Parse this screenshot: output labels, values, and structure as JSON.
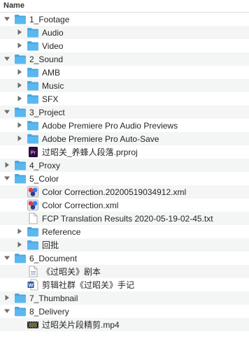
{
  "header": {
    "column_name": "Name"
  },
  "colors": {
    "folder": "#5bb8ef",
    "folder_tab": "#4aa6df",
    "row_alt": "#f4f5f5",
    "premiere": "#2a0f3d",
    "premiere_text": "#e18ef2",
    "word": "#2b579a"
  },
  "rows": [
    {
      "name": "1_Footage",
      "depth": 0,
      "icon": "folder-icon",
      "expandable": true,
      "expanded": true
    },
    {
      "name": "Audio",
      "depth": 1,
      "icon": "folder-icon",
      "expandable": true,
      "expanded": false
    },
    {
      "name": "Video",
      "depth": 1,
      "icon": "folder-icon",
      "expandable": true,
      "expanded": false
    },
    {
      "name": "2_Sound",
      "depth": 0,
      "icon": "folder-icon",
      "expandable": true,
      "expanded": true
    },
    {
      "name": "AMB",
      "depth": 1,
      "icon": "folder-icon",
      "expandable": true,
      "expanded": false
    },
    {
      "name": "Music",
      "depth": 1,
      "icon": "folder-icon",
      "expandable": true,
      "expanded": false
    },
    {
      "name": "SFX",
      "depth": 1,
      "icon": "folder-icon",
      "expandable": true,
      "expanded": false
    },
    {
      "name": "3_Project",
      "depth": 0,
      "icon": "folder-icon",
      "expandable": true,
      "expanded": true
    },
    {
      "name": "Adobe Premiere Pro Audio Previews",
      "depth": 1,
      "icon": "folder-icon",
      "expandable": true,
      "expanded": false
    },
    {
      "name": "Adobe Premiere Pro Auto-Save",
      "depth": 1,
      "icon": "folder-icon",
      "expandable": true,
      "expanded": false
    },
    {
      "name": "过昭关_养蜂人段落.prproj",
      "depth": 1,
      "icon": "premiere-file-icon",
      "expandable": false,
      "badge": "Pr"
    },
    {
      "name": "4_Proxy",
      "depth": 0,
      "icon": "folder-icon",
      "expandable": true,
      "expanded": false
    },
    {
      "name": "5_Color",
      "depth": 0,
      "icon": "folder-icon",
      "expandable": true,
      "expanded": true
    },
    {
      "name": "Color Correction.20200519034912.xml",
      "depth": 1,
      "icon": "color-xml-file-icon",
      "expandable": false
    },
    {
      "name": "Color Correction.xml",
      "depth": 1,
      "icon": "color-xml-file-icon",
      "expandable": false
    },
    {
      "name": "FCP Translation Results 2020-05-19-02-45.txt",
      "depth": 1,
      "icon": "text-file-icon",
      "expandable": false
    },
    {
      "name": "Reference",
      "depth": 1,
      "icon": "folder-icon",
      "expandable": true,
      "expanded": false
    },
    {
      "name": "回批",
      "depth": 1,
      "icon": "folder-icon",
      "expandable": true,
      "expanded": false
    },
    {
      "name": "6_Document",
      "depth": 0,
      "icon": "folder-icon",
      "expandable": true,
      "expanded": true
    },
    {
      "name": "《过昭关》剧本",
      "depth": 1,
      "icon": "pages-file-icon",
      "expandable": false
    },
    {
      "name": "剪辑社群《过昭关》手记",
      "depth": 1,
      "icon": "word-file-icon",
      "expandable": false,
      "badge": "W"
    },
    {
      "name": "7_Thumbnail",
      "depth": 0,
      "icon": "folder-icon",
      "expandable": true,
      "expanded": false
    },
    {
      "name": "8_Delivery",
      "depth": 0,
      "icon": "folder-icon",
      "expandable": true,
      "expanded": true
    },
    {
      "name": "过昭关片段精剪.mp4",
      "depth": 1,
      "icon": "video-file-icon",
      "expandable": false
    }
  ]
}
